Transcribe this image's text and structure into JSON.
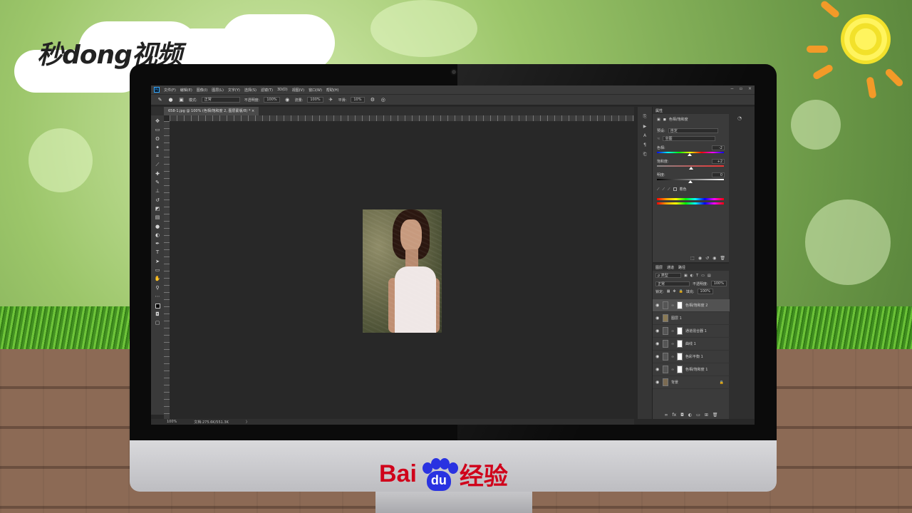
{
  "brand": {
    "logo_text": "秒dong视频"
  },
  "footer_logo": {
    "left": "Bai",
    "paw": "du",
    "right": "经验"
  },
  "photoshop": {
    "menu": [
      "文件(F)",
      "编辑(E)",
      "图像(I)",
      "图层(L)",
      "文字(Y)",
      "选择(S)",
      "滤镜(T)",
      "3D(D)",
      "视图(V)",
      "窗口(W)",
      "帮助(H)"
    ],
    "window_controls": [
      "−",
      "▫",
      "×"
    ],
    "options": {
      "mode_label": "模式:",
      "mode_value": "正常",
      "opacity_label": "不透明度:",
      "opacity_value": "100%",
      "flow_label": "流量:",
      "flow_value": "100%",
      "smooth_label": "平滑:",
      "smooth_value": "10%"
    },
    "document_tab": "658-1.jpg @ 100% (色相/饱和度 2, 图层蒙版/8) * ×",
    "status": {
      "zoom": "100%",
      "doc_size": "文档:275.6K/551.3K"
    },
    "properties": {
      "title": "属性",
      "adjust_name": "色相/饱和度",
      "preset_label": "预设:",
      "preset_value": "自定",
      "channel_value": "全图",
      "hue_label": "色相:",
      "hue_value": "-2",
      "hue_pos": 0.49,
      "sat_label": "饱和度:",
      "sat_value": "+2",
      "sat_pos": 0.51,
      "light_label": "明度:",
      "light_value": "0",
      "light_pos": 0.5,
      "colorize_label": "着色"
    },
    "layers_panel": {
      "tabs": [
        "图层",
        "通道",
        "路径"
      ],
      "kind_label": "ρ 类型",
      "blend_mode": "正常",
      "opacity_label": "不透明度:",
      "opacity_value": "100%",
      "lock_label": "锁定:",
      "fill_label": "填充:",
      "fill_value": "100%",
      "layers": [
        {
          "name": "色相/饱和度 2",
          "selected": true,
          "mask": true
        },
        {
          "name": "图层 1",
          "selected": false,
          "mask": false
        },
        {
          "name": "通道混合器 1",
          "selected": false,
          "mask": true
        },
        {
          "name": "曲线 1",
          "selected": false,
          "mask": true
        },
        {
          "name": "色彩平衡 1",
          "selected": false,
          "mask": true
        },
        {
          "name": "色相/饱和度 1",
          "selected": false,
          "mask": true
        },
        {
          "name": "背景",
          "selected": false,
          "mask": false
        }
      ]
    }
  }
}
